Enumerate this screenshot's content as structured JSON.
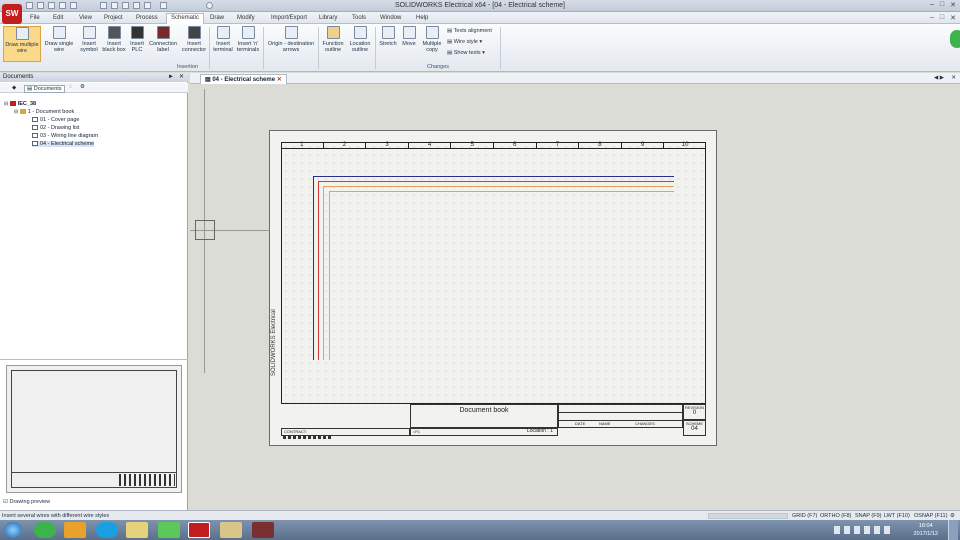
{
  "window": {
    "title": "SOLIDWORKS Electrical x64 - [04 - Electrical scheme]",
    "logo": "SW"
  },
  "menu": [
    "File",
    "Edit",
    "View",
    "Project",
    "Process",
    "Schematic",
    "Draw",
    "Modify",
    "Import/Export",
    "Library",
    "Tools",
    "Window",
    "Help"
  ],
  "menu_active": "Schematic",
  "ribbon": {
    "buttons": [
      {
        "label": "Draw multiple wire",
        "icon": "multi-wire-icon"
      },
      {
        "label": "Draw single wire",
        "icon": "single-wire-icon"
      },
      {
        "label": "Insert symbol",
        "icon": "symbol-icon"
      },
      {
        "label": "Insert black box",
        "icon": "black-box-icon"
      },
      {
        "label": "Insert PLC",
        "icon": "plc-icon"
      },
      {
        "label": "Connection label",
        "icon": "connection-label-icon"
      },
      {
        "label": "Insert connector",
        "icon": "connector-icon"
      },
      {
        "label": "Insert terminal",
        "icon": "terminal-icon"
      },
      {
        "label": "Insert 'n' terminals",
        "icon": "n-terminals-icon"
      },
      {
        "label": "Origin - destination arrows",
        "icon": "arrows-icon"
      },
      {
        "label": "Function outline",
        "icon": "function-outline-icon"
      },
      {
        "label": "Location outline",
        "icon": "location-outline-icon"
      },
      {
        "label": "Stretch",
        "icon": "stretch-icon"
      },
      {
        "label": "Move",
        "icon": "move-icon"
      },
      {
        "label": "Multiple copy",
        "icon": "multiple-copy-icon"
      }
    ],
    "small_buttons": [
      "Texts alignment",
      "Wire style",
      "Show texts"
    ],
    "groups": {
      "insertion": "Insertion",
      "changes": "Changes"
    }
  },
  "documents_panel": {
    "title": "Documents",
    "toolbar_label": "Documents",
    "tree": [
      {
        "label": "IEC_38",
        "level": 0
      },
      {
        "label": "1 - Document book",
        "level": 1
      },
      {
        "label": "01 - Cover page",
        "level": 2
      },
      {
        "label": "02 - Drawing list",
        "level": 2
      },
      {
        "label": "03 - Wiring line diagram",
        "level": 2
      },
      {
        "label": "04 - Electrical scheme",
        "level": 2
      }
    ],
    "preview_label": "Drawing preview"
  },
  "active_tab": "04 - Electrical scheme",
  "sheet": {
    "columns": [
      "1",
      "2",
      "3",
      "4",
      "5",
      "6",
      "7",
      "8",
      "9",
      "10"
    ],
    "title_block_title": "Document book",
    "vertical_label": "SOLIDWORKS Electrical",
    "location": "Location : 1",
    "function": "=F1",
    "contract": "CONTRACT:",
    "revision_label": "REVISION",
    "revision": "0",
    "scheme_label": "SCHEME",
    "scheme": "04",
    "date_label": "DATE",
    "name_label": "NAME",
    "changes_label": "CHANGES"
  },
  "wire_colors": [
    "#2b2b8a",
    "#d43a3a",
    "#e8a060",
    "#c9a98a"
  ],
  "status": {
    "hint": "Insert several wires with different wire styles",
    "toggles": [
      "GRID (F7)",
      "ORTHO (F8)",
      "SNAP (F9)",
      "LWT (F10)",
      "OSNAP (F11)"
    ]
  },
  "clock": {
    "time": "18:04",
    "date": "2017/1/12"
  }
}
